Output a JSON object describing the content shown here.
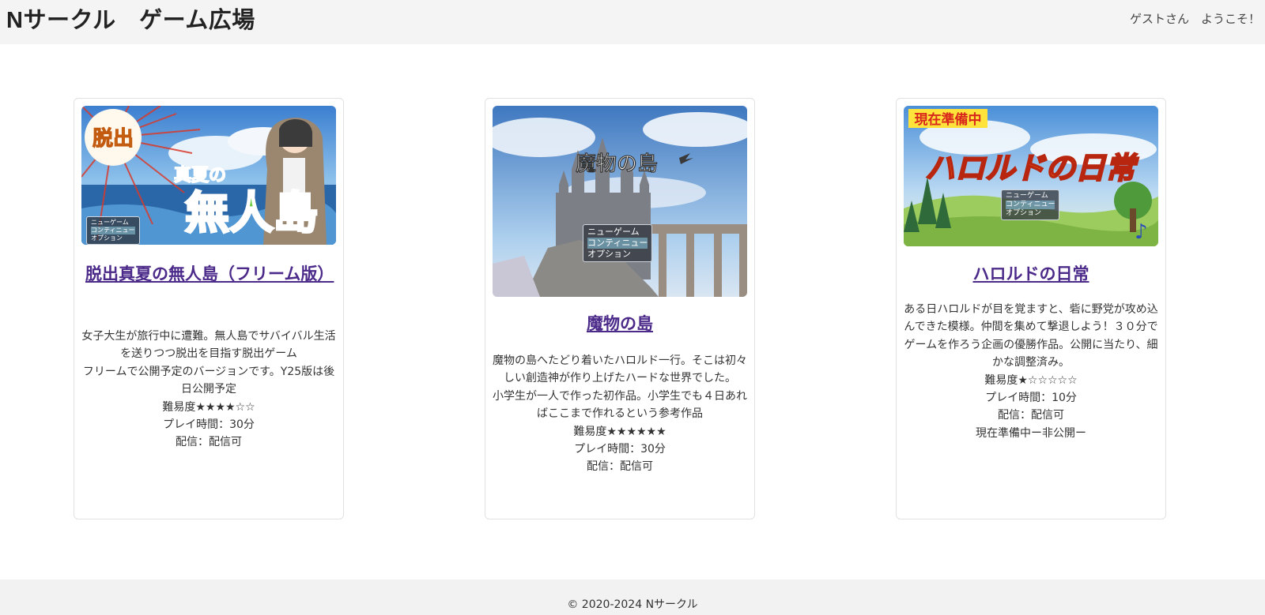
{
  "header": {
    "title": "Nサークル　ゲーム広場",
    "welcome": "ゲストさん　ようこそ！"
  },
  "cards": [
    {
      "title": "脱出真夏の無人島（フリーム版）",
      "thumbnail": {
        "badge": "脱出",
        "caption_small": "真夏の",
        "caption_large": "無人島",
        "menu": [
          "ニューゲーム",
          "コンティニュー",
          "オプション"
        ]
      },
      "description": [
        "女子大生が旅行中に遭難。無人島でサバイバル生活を送りつつ脱出を目指す脱出ゲーム",
        "フリームで公開予定のバージョンです。Y25版は後日公開予定"
      ],
      "difficulty": "難易度★★★★☆☆",
      "playtime": "プレイ時間：30分",
      "streaming": "配信：配信可"
    },
    {
      "title": "魔物の島",
      "thumbnail": {
        "caption": "魔物の島",
        "menu": [
          "ニューゲーム",
          "コンティニュー",
          "オプション"
        ]
      },
      "description": [
        "魔物の島へたどり着いたハロルド一行。そこは初々しい創造神が作り上げたハードな世界でした。",
        "小学生が一人で作った初作品。小学生でも４日あればここまで作れるという参考作品"
      ],
      "difficulty": "難易度★★★★★★",
      "playtime": "プレイ時間：30分",
      "streaming": "配信：配信可"
    },
    {
      "title": "ハロルドの日常",
      "thumbnail": {
        "badge": "現在準備中",
        "caption": "ハロルドの日常",
        "menu": [
          "ニューゲーム",
          "コンティニュー",
          "オプション"
        ]
      },
      "description": [
        "ある日ハロルドが目を覚ますと、砦に野党が攻め込んできた模様。仲間を集めて撃退しよう！３０分でゲームを作ろう企画の優勝作品。公開に当たり、細かな調整済み。"
      ],
      "difficulty": "難易度★☆☆☆☆☆",
      "playtime": "プレイ時間：10分",
      "streaming": "配信：配信可",
      "status": "現在準備中ー非公開ー"
    }
  ],
  "footer": {
    "copyright": "© 2020-2024 Nサークル"
  },
  "colors": {
    "link": "#4b2a8a",
    "header_bg": "#f4f4f4",
    "footer_bg": "#f2f2f2",
    "card_border": "#e2e2e2"
  }
}
